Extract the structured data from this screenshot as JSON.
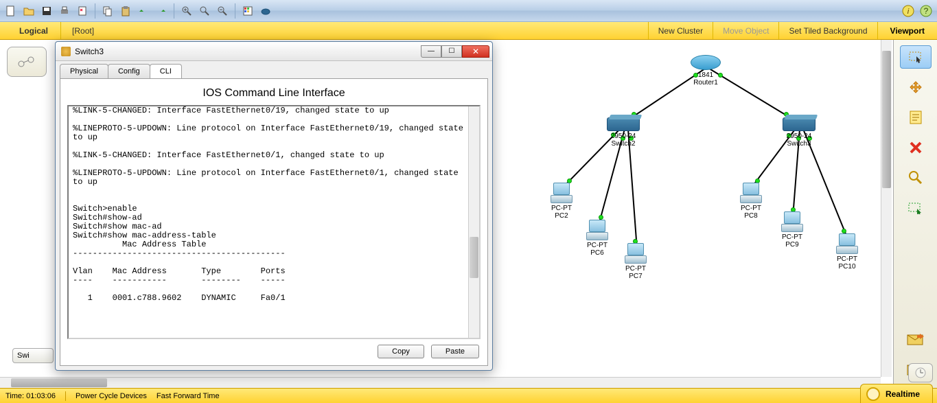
{
  "logical_bar": {
    "tab_label": "Logical",
    "root_label": "[Root]",
    "new_cluster": "New Cluster",
    "move_object": "Move Object",
    "set_tiled_bg": "Set Tiled Background",
    "viewport": "Viewport"
  },
  "status": {
    "time_label": "Time: 01:03:06",
    "pcd": "Power Cycle Devices",
    "fft": "Fast Forward Time",
    "realtime_label": "Realtime"
  },
  "side_tab2_label": "Swi",
  "dialog": {
    "title": "Switch3",
    "tabs": {
      "physical": "Physical",
      "config": "Config",
      "cli": "CLI"
    },
    "cli_title": "IOS Command Line Interface",
    "copy_btn": "Copy",
    "paste_btn": "Paste",
    "cli_text": "%LINK-5-CHANGED: Interface FastEthernet0/19, changed state to up\n\n%LINEPROTO-5-UPDOWN: Line protocol on Interface FastEthernet0/19, changed state to up\n\n%LINK-5-CHANGED: Interface FastEthernet0/1, changed state to up\n\n%LINEPROTO-5-UPDOWN: Line protocol on Interface FastEthernet0/1, changed state to up\n\n\nSwitch>enable\nSwitch#show-ad\nSwitch#show mac-ad\nSwitch#show mac-address-table\n          Mac Address Table\n-------------------------------------------\n\nVlan    Mac Address       Type        Ports\n----    -----------       --------    -----\n\n   1    0001.c788.9602    DYNAMIC     Fa0/1"
  },
  "devices": {
    "router1": {
      "type": "1841",
      "name": "Router1"
    },
    "switch2": {
      "type": "2950-24",
      "name": "Switch2"
    },
    "switch3": {
      "type": "2950-24",
      "name": "Switch3"
    },
    "pc2": {
      "type": "PC-PT",
      "name": "PC2"
    },
    "pc6": {
      "type": "PC-PT",
      "name": "PC6"
    },
    "pc7": {
      "type": "PC-PT",
      "name": "PC7"
    },
    "pc8": {
      "type": "PC-PT",
      "name": "PC8"
    },
    "pc9": {
      "type": "PC-PT",
      "name": "PC9"
    },
    "pc10": {
      "type": "PC-PT",
      "name": "PC10"
    }
  }
}
